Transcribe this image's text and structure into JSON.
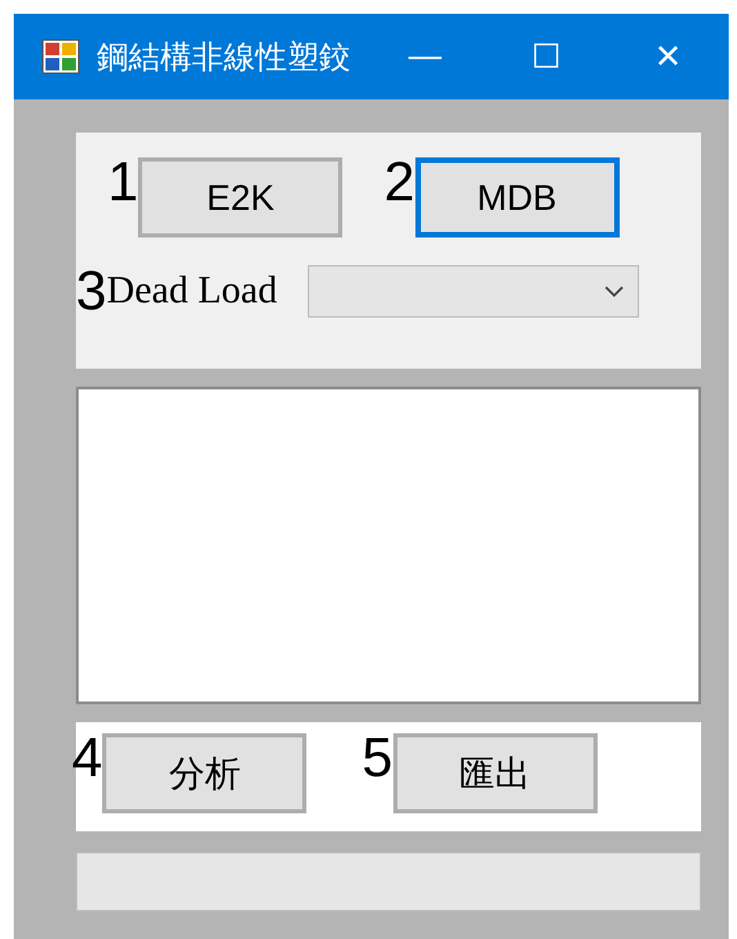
{
  "window": {
    "title": "鋼結構非線性塑鉸",
    "controls": [
      "—",
      "☐",
      "✕"
    ]
  },
  "top_panel": {
    "buttons": [
      {
        "marker": "1",
        "label": "E2K",
        "focused": false
      },
      {
        "marker": "2",
        "label": "MDB",
        "focused": true
      }
    ],
    "dead_load": {
      "marker": "3",
      "label": "Dead Load"
    }
  },
  "bottom_panel": {
    "buttons": [
      {
        "marker": "4",
        "label": "分析",
        "focused": false
      },
      {
        "marker": "5",
        "label": "匯出",
        "focused": false
      }
    ]
  },
  "progress": {
    "level": 0
  }
}
